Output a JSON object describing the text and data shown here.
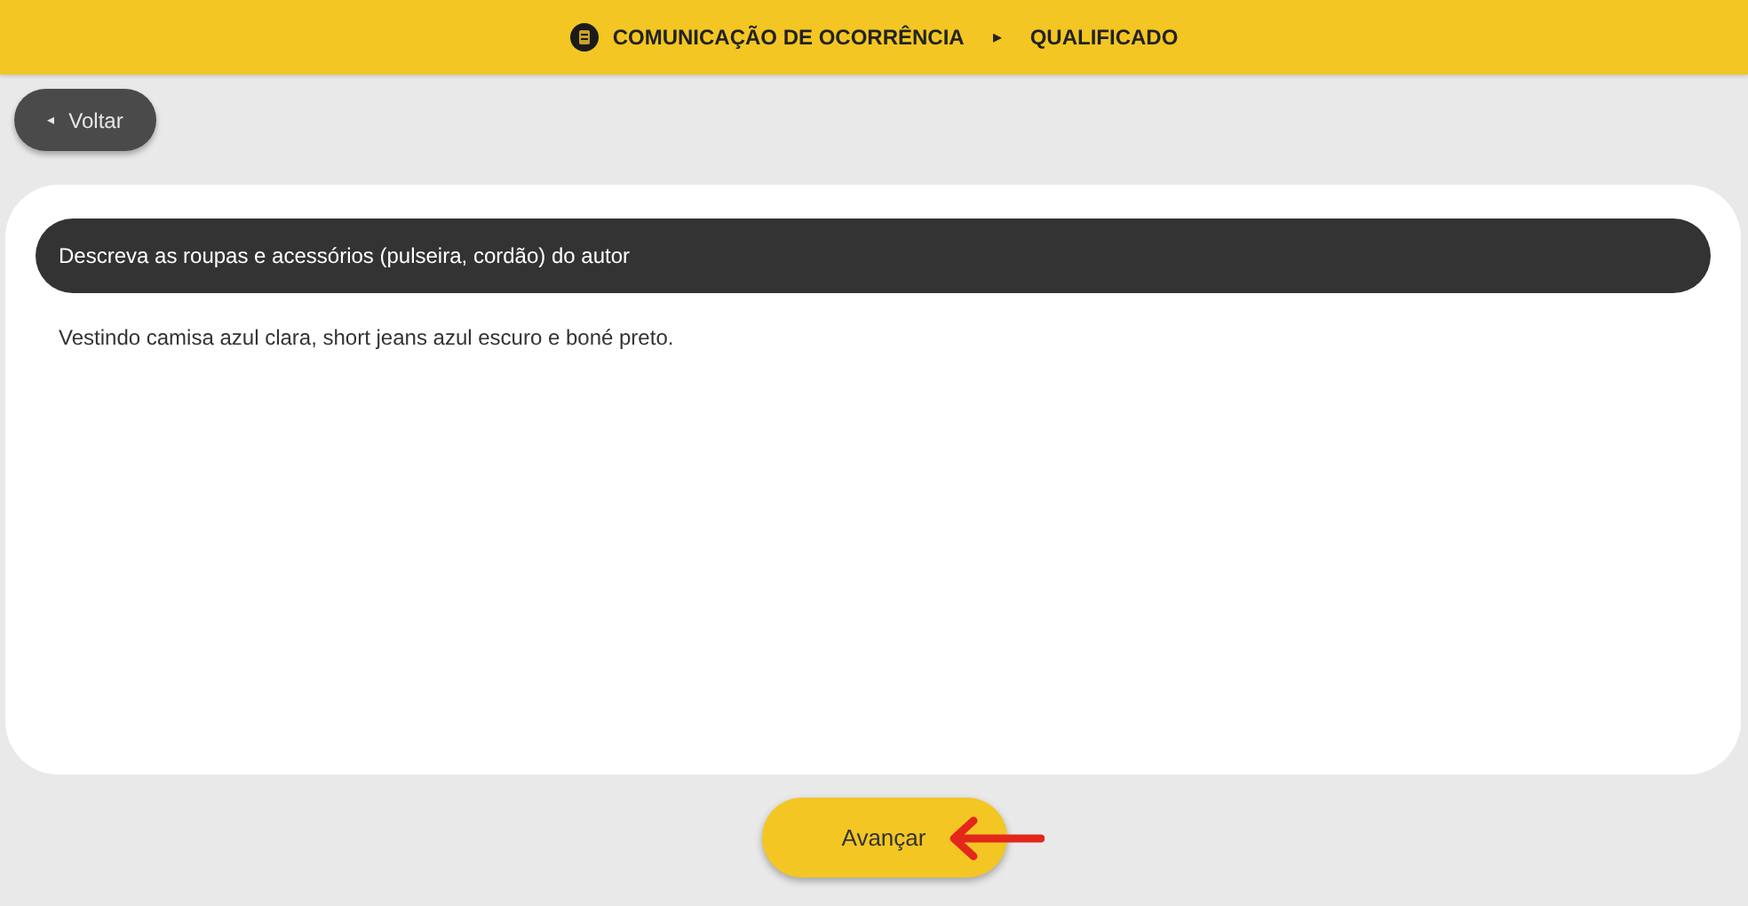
{
  "header": {
    "steps": [
      "COMUNICAÇÃO DE OCORRÊNCIA",
      "QUALIFICADO"
    ],
    "separator": "▸"
  },
  "back_button": {
    "icon": "◂",
    "label": "Voltar"
  },
  "question": {
    "label": "Descreva as roupas e acessórios (pulseira, cordão) do autor",
    "answer": "Vestindo camisa azul clara, short jeans azul escuro e boné preto."
  },
  "next_button": {
    "label": "Avançar"
  }
}
